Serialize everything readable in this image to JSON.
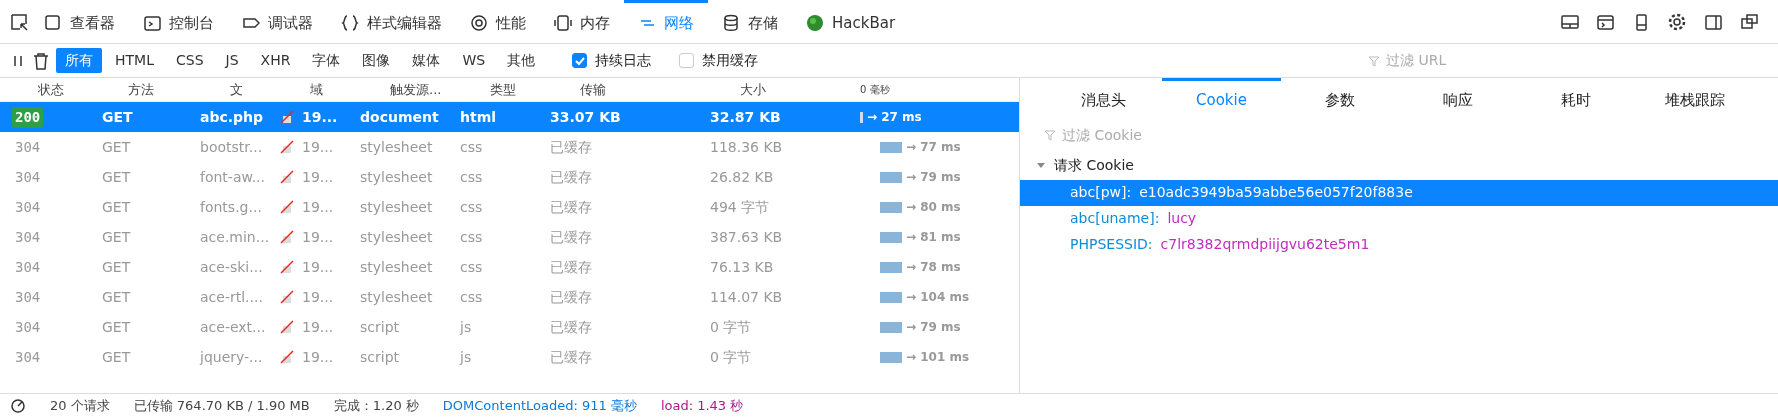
{
  "toolbox_tabs": [
    {
      "label": "查看器",
      "kind": "inspector",
      "selected": false
    },
    {
      "label": "控制台",
      "kind": "console",
      "selected": false
    },
    {
      "label": "调试器",
      "kind": "debugger",
      "selected": false
    },
    {
      "label": "样式编辑器",
      "kind": "braces",
      "selected": false
    },
    {
      "label": "性能",
      "kind": "gauge",
      "selected": false
    },
    {
      "label": "内存",
      "kind": "memory",
      "selected": false
    },
    {
      "label": "网络",
      "kind": "network",
      "selected": true
    },
    {
      "label": "存储",
      "kind": "storage",
      "selected": false
    },
    {
      "label": "HackBar",
      "kind": "hackbar",
      "selected": false
    }
  ],
  "type_filters": [
    {
      "label": "所有",
      "selected": true
    },
    {
      "label": "HTML",
      "selected": false
    },
    {
      "label": "CSS",
      "selected": false
    },
    {
      "label": "JS",
      "selected": false
    },
    {
      "label": "XHR",
      "selected": false
    },
    {
      "label": "字体",
      "selected": false
    },
    {
      "label": "图像",
      "selected": false
    },
    {
      "label": "媒体",
      "selected": false
    },
    {
      "label": "WS",
      "selected": false
    },
    {
      "label": "其他",
      "selected": false
    }
  ],
  "options": [
    {
      "label": "持续日志",
      "checked": true
    },
    {
      "label": "禁用缓存",
      "checked": false
    }
  ],
  "url_filter": {
    "placeholder": "过滤 URL"
  },
  "columns": [
    "状态",
    "方法",
    "文",
    "域",
    "触发源...",
    "类型",
    "传输",
    "大小",
    "0 毫秒"
  ],
  "requests": [
    {
      "status": "200",
      "method": "GET",
      "file": "abc.php",
      "domain": "19...",
      "cause": "document",
      "type": "html",
      "transferred": "33.07 KB",
      "size": "32.87 KB",
      "timing": "→ 27 ms",
      "cached": false,
      "selected": true
    },
    {
      "status": "304",
      "method": "GET",
      "file": "bootstr...",
      "domain": "19...",
      "cause": "stylesheet",
      "type": "css",
      "transferred": "已缓存",
      "size": "118.36 KB",
      "timing": "→ 77 ms",
      "cached": true,
      "selected": false
    },
    {
      "status": "304",
      "method": "GET",
      "file": "font-aw...",
      "domain": "19...",
      "cause": "stylesheet",
      "type": "css",
      "transferred": "已缓存",
      "size": "26.82 KB",
      "timing": "→ 79 ms",
      "cached": true,
      "selected": false
    },
    {
      "status": "304",
      "method": "GET",
      "file": "fonts.g...",
      "domain": "19...",
      "cause": "stylesheet",
      "type": "css",
      "transferred": "已缓存",
      "size": "494 字节",
      "timing": "→ 80 ms",
      "cached": true,
      "selected": false
    },
    {
      "status": "304",
      "method": "GET",
      "file": "ace.min...",
      "domain": "19...",
      "cause": "stylesheet",
      "type": "css",
      "transferred": "已缓存",
      "size": "387.63 KB",
      "timing": "→ 81 ms",
      "cached": true,
      "selected": false
    },
    {
      "status": "304",
      "method": "GET",
      "file": "ace-ski...",
      "domain": "19...",
      "cause": "stylesheet",
      "type": "css",
      "transferred": "已缓存",
      "size": "76.13 KB",
      "timing": "→ 78 ms",
      "cached": true,
      "selected": false
    },
    {
      "status": "304",
      "method": "GET",
      "file": "ace-rtl....",
      "domain": "19...",
      "cause": "stylesheet",
      "type": "css",
      "transferred": "已缓存",
      "size": "114.07 KB",
      "timing": "→ 104 ms",
      "cached": true,
      "selected": false
    },
    {
      "status": "304",
      "method": "GET",
      "file": "ace-ext...",
      "domain": "19...",
      "cause": "script",
      "type": "js",
      "transferred": "已缓存",
      "size": "0 字节",
      "timing": "→ 79 ms",
      "cached": true,
      "selected": false
    },
    {
      "status": "304",
      "method": "GET",
      "file": "jquery-...",
      "domain": "19...",
      "cause": "script",
      "type": "js",
      "transferred": "已缓存",
      "size": "0 字节",
      "timing": "→ 101 ms",
      "cached": true,
      "selected": false
    }
  ],
  "detail_tabs": [
    {
      "label": "消息头",
      "selected": false
    },
    {
      "label": "Cookie",
      "selected": true
    },
    {
      "label": "参数",
      "selected": false
    },
    {
      "label": "响应",
      "selected": false
    },
    {
      "label": "耗时",
      "selected": false
    },
    {
      "label": "堆栈跟踪",
      "selected": false
    }
  ],
  "cookie_filter": {
    "placeholder": "过滤 Cookie"
  },
  "cookie_tree": {
    "label": "请求 Cookie",
    "expanded": true,
    "children": [
      {
        "name": "abc[pw]:",
        "value": "e10adc3949ba59abbe56e057f20f883e",
        "selected": true
      },
      {
        "name": "abc[uname]:",
        "value": "lucy",
        "selected": false
      },
      {
        "name": "PHPSESSID:",
        "value": "c7lr8382qrmdpiijgvu62te5m1",
        "selected": false
      }
    ]
  },
  "status_bar": {
    "requests": "20 个请求",
    "transferred": "已传输 764.70 KB / 1.90 MB",
    "finish": "完成：1.20 秒",
    "dom_loaded": "DOMContentLoaded: 911 毫秒",
    "load": "load: 1.43 秒"
  }
}
